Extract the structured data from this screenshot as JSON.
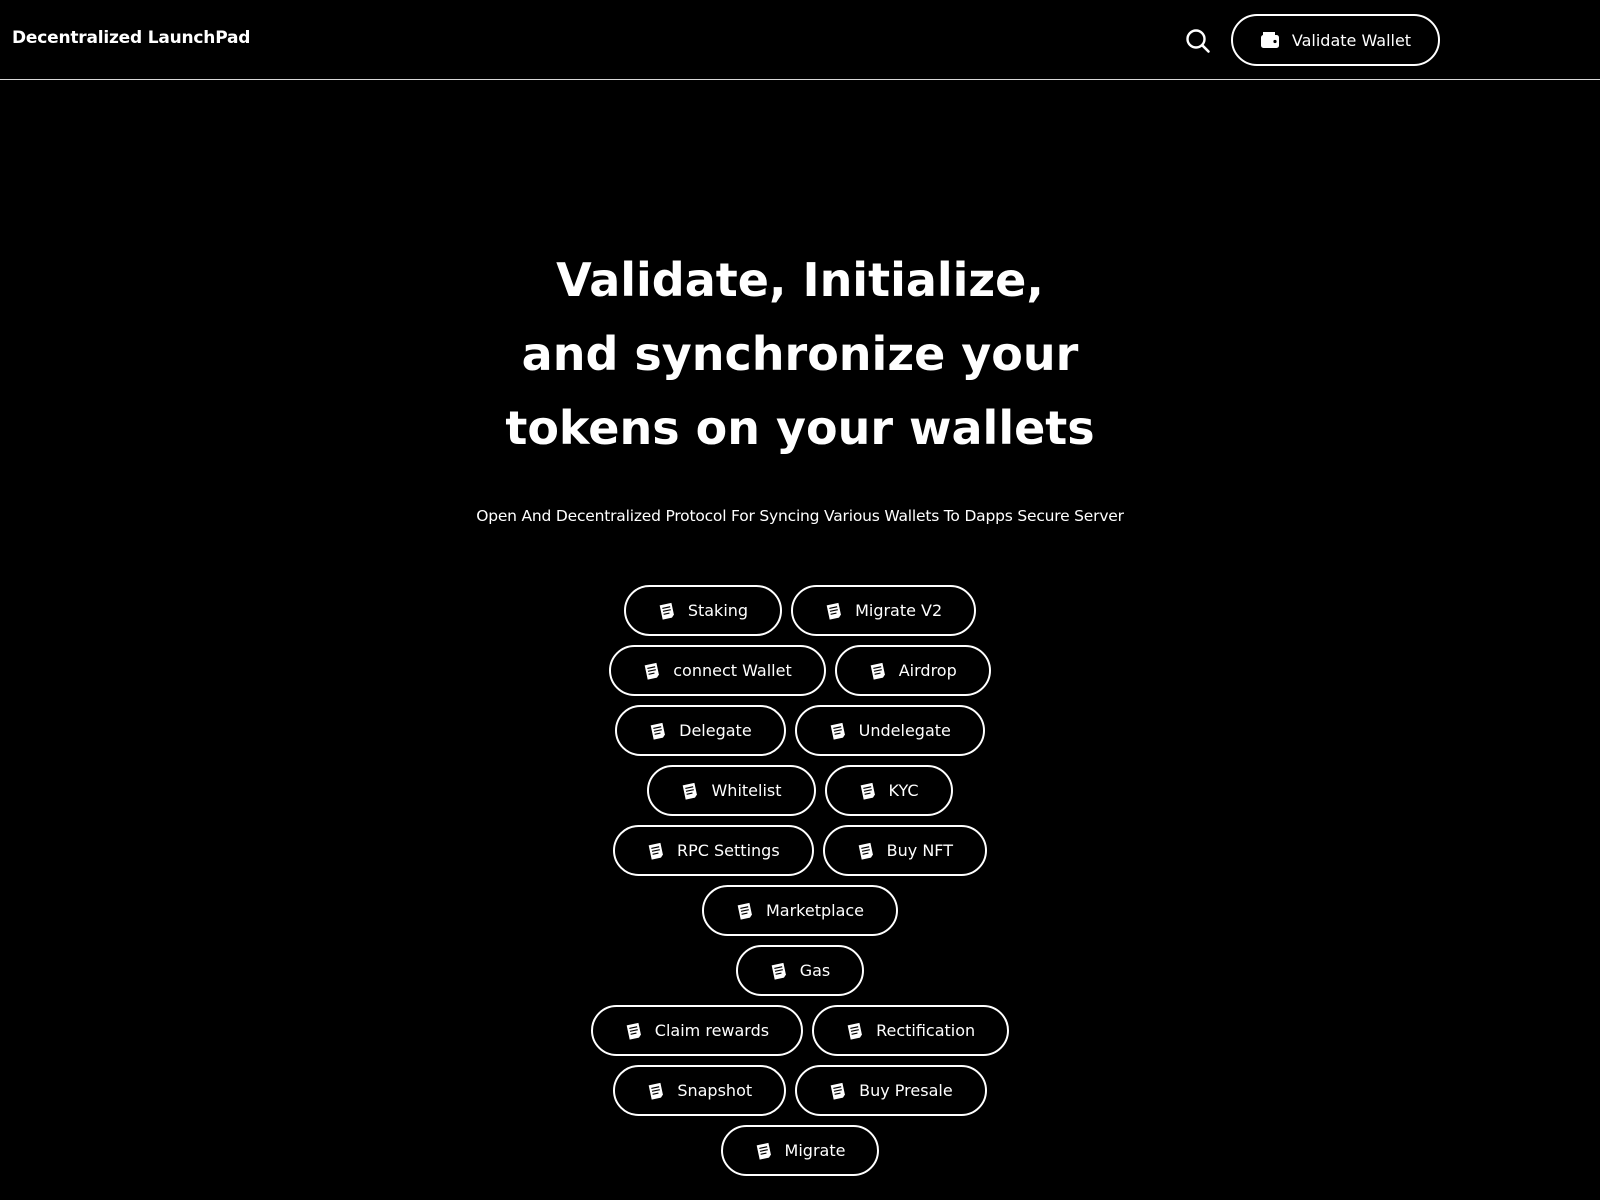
{
  "header": {
    "brand": "Decentralized LaunchPad",
    "search_icon": "search-icon",
    "wallet_button": {
      "label": "Validate Wallet",
      "icon": "wallet-icon"
    }
  },
  "hero": {
    "title_lines": [
      "Validate, Initialize,",
      "and synchronize your",
      "tokens on your wallets"
    ],
    "subtitle": "Open And Decentralized Protocol For Syncing Various Wallets To Dapps Secure Server"
  },
  "actions": {
    "icon": "note-icon",
    "rows": [
      [
        {
          "label": "Staking"
        },
        {
          "label": "Migrate V2"
        }
      ],
      [
        {
          "label": "connect Wallet"
        },
        {
          "label": "Airdrop"
        }
      ],
      [
        {
          "label": "Delegate"
        },
        {
          "label": "Undelegate"
        }
      ],
      [
        {
          "label": "Whitelist"
        },
        {
          "label": "KYC"
        }
      ],
      [
        {
          "label": "RPC Settings"
        },
        {
          "label": "Buy NFT"
        }
      ],
      [
        {
          "label": "Marketplace"
        }
      ],
      [
        {
          "label": "Gas"
        }
      ],
      [
        {
          "label": "Claim rewards"
        },
        {
          "label": "Rectification"
        }
      ],
      [
        {
          "label": "Snapshot"
        },
        {
          "label": "Buy Presale"
        }
      ],
      [
        {
          "label": "Migrate"
        }
      ]
    ]
  },
  "colors": {
    "background": "#000000",
    "foreground": "#ffffff",
    "divider": "#d8d8d8"
  }
}
